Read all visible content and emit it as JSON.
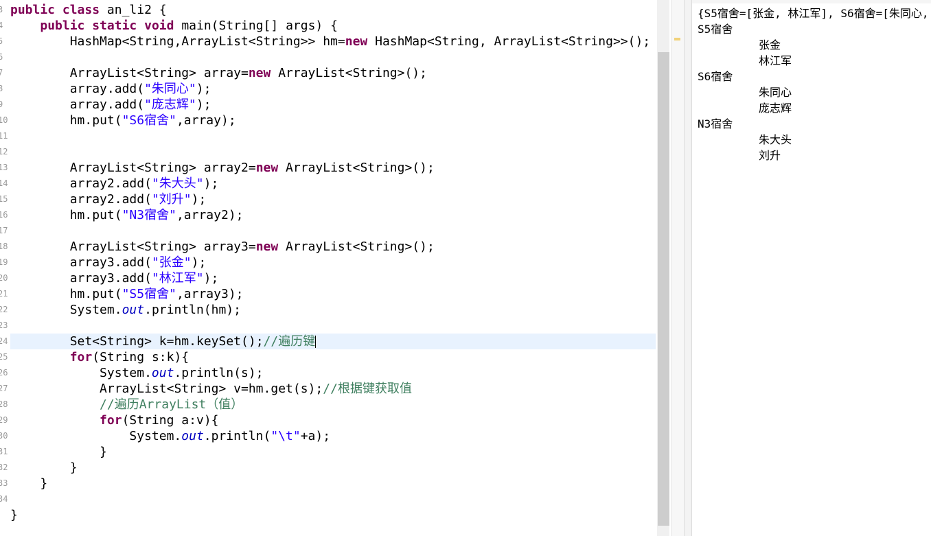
{
  "editor": {
    "gutter_numbers": [
      "3",
      "4",
      "5",
      "6",
      "7",
      "8",
      "9",
      "10",
      "11",
      "12",
      "13",
      "14",
      "15",
      "16",
      "17",
      "18",
      "19",
      "20",
      "21",
      "22",
      "23",
      "24",
      "25",
      "26",
      "27",
      "28",
      "29",
      "30",
      "31",
      "32",
      "33",
      "34"
    ],
    "lines": [
      {
        "t": "public class an_li2 {"
      },
      {
        "t": "    public static void main(String[] args) {"
      },
      {
        "t": "        HashMap<String,ArrayList<String>> hm=new HashMap<String, ArrayList<String>>();"
      },
      {
        "t": ""
      },
      {
        "t": "        ArrayList<String> array=new ArrayList<String>();"
      },
      {
        "t": "        array.add(\"朱同心\");"
      },
      {
        "t": "        array.add(\"庞志辉\");"
      },
      {
        "t": "        hm.put(\"S6宿舍\",array);"
      },
      {
        "t": ""
      },
      {
        "t": ""
      },
      {
        "t": "        ArrayList<String> array2=new ArrayList<String>();"
      },
      {
        "t": "        array2.add(\"朱大头\");"
      },
      {
        "t": "        array2.add(\"刘升\");"
      },
      {
        "t": "        hm.put(\"N3宿舍\",array2);"
      },
      {
        "t": ""
      },
      {
        "t": "        ArrayList<String> array3=new ArrayList<String>();"
      },
      {
        "t": "        array3.add(\"张金\");"
      },
      {
        "t": "        array3.add(\"林江军\");"
      },
      {
        "t": "        hm.put(\"S5宿舍\",array3);"
      },
      {
        "t": "        System.out.println(hm);"
      },
      {
        "t": ""
      },
      {
        "t": "        Set<String> k=hm.keySet();//遍历键"
      },
      {
        "t": "        for(String s:k){"
      },
      {
        "t": "            System.out.println(s);"
      },
      {
        "t": "            ArrayList<String> v=hm.get(s);//根据键获取值"
      },
      {
        "t": "            //遍历ArrayList（值）"
      },
      {
        "t": "            for(String a:v){"
      },
      {
        "t": "                System.out.println(\"\\t\"+a);"
      },
      {
        "t": "            }"
      },
      {
        "t": "        }"
      },
      {
        "t": "    }"
      },
      {
        "t": ""
      },
      {
        "t": "}"
      }
    ]
  },
  "console": {
    "lines": [
      {
        "text": "{S5宿舍=[张金, 林江军], S6宿舍=[朱同心,",
        "indent": false
      },
      {
        "text": "S5宿舍",
        "indent": false
      },
      {
        "text": "张金",
        "indent": true
      },
      {
        "text": "林江军",
        "indent": true
      },
      {
        "text": "S6宿舍",
        "indent": false
      },
      {
        "text": "朱同心",
        "indent": true
      },
      {
        "text": "庞志辉",
        "indent": true
      },
      {
        "text": "N3宿舍",
        "indent": false
      },
      {
        "text": "朱大头",
        "indent": true
      },
      {
        "text": "刘升",
        "indent": true
      }
    ]
  },
  "colors": {
    "keyword": "#7f0055",
    "string": "#2a00ff",
    "comment": "#3f7f5f",
    "static_field": "#0000c0",
    "current_line": "#e8f2fe"
  }
}
